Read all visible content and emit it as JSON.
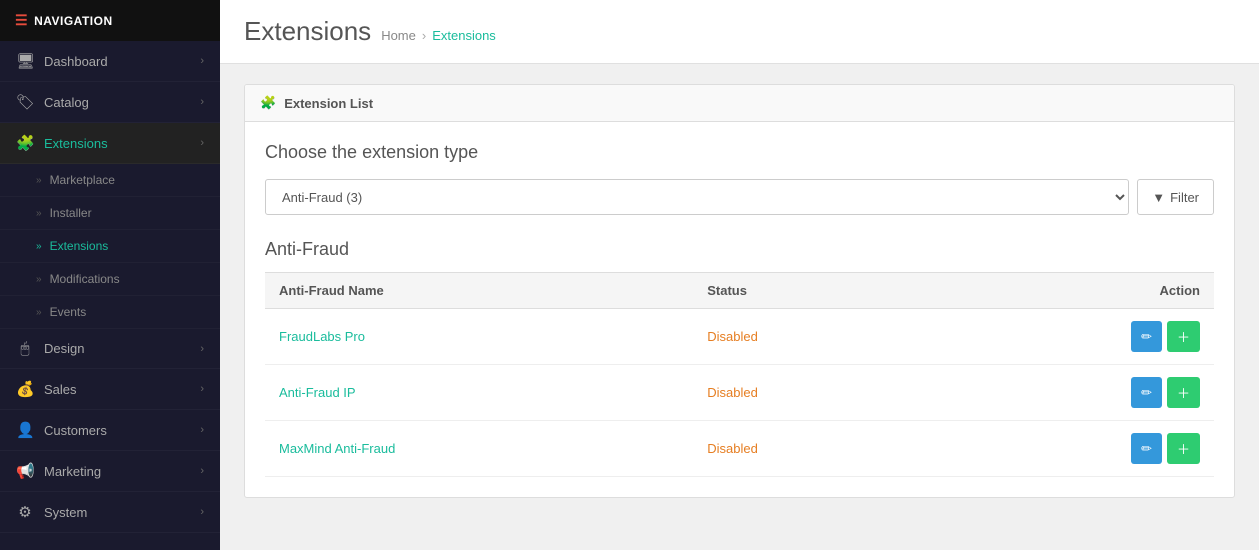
{
  "nav": {
    "header": "NAVIGATION",
    "items": [
      {
        "id": "dashboard",
        "label": "Dashboard",
        "icon": "🖥",
        "hasChevron": true,
        "active": false
      },
      {
        "id": "catalog",
        "label": "Catalog",
        "icon": "🏷",
        "hasChevron": true,
        "active": false
      },
      {
        "id": "extensions",
        "label": "Extensions",
        "icon": "🧩",
        "hasChevron": true,
        "active": true
      }
    ],
    "subItems": [
      {
        "id": "marketplace",
        "label": "Marketplace",
        "active": false
      },
      {
        "id": "installer",
        "label": "Installer",
        "active": false
      },
      {
        "id": "extensions-sub",
        "label": "Extensions",
        "active": true
      },
      {
        "id": "modifications",
        "label": "Modifications",
        "active": false
      },
      {
        "id": "events",
        "label": "Events",
        "active": false
      }
    ],
    "bottomItems": [
      {
        "id": "design",
        "label": "Design",
        "icon": "🖱",
        "hasChevron": true
      },
      {
        "id": "sales",
        "label": "Sales",
        "icon": "💰",
        "hasChevron": true
      },
      {
        "id": "customers",
        "label": "Customers",
        "icon": "👤",
        "hasChevron": true
      },
      {
        "id": "marketing",
        "label": "Marketing",
        "icon": "📢",
        "hasChevron": true
      },
      {
        "id": "system",
        "label": "System",
        "icon": "⚙",
        "hasChevron": true
      }
    ]
  },
  "page": {
    "title": "Extensions",
    "breadcrumb_home": "Home",
    "breadcrumb_sep": "›",
    "breadcrumb_current": "Extensions"
  },
  "panel": {
    "heading": "Extension List"
  },
  "filter": {
    "section_title": "Choose the extension type",
    "select_value": "Anti-Fraud (3)",
    "filter_btn": "Filter",
    "filter_icon": "▼"
  },
  "table": {
    "section_title": "Anti-Fraud",
    "columns": [
      "Anti-Fraud Name",
      "Status",
      "Action"
    ],
    "rows": [
      {
        "name": "FraudLabs Pro",
        "status": "Disabled"
      },
      {
        "name": "Anti-Fraud IP",
        "status": "Disabled"
      },
      {
        "name": "MaxMind Anti-Fraud",
        "status": "Disabled"
      }
    ],
    "btn_edit_title": "Edit",
    "btn_add_title": "Add"
  }
}
